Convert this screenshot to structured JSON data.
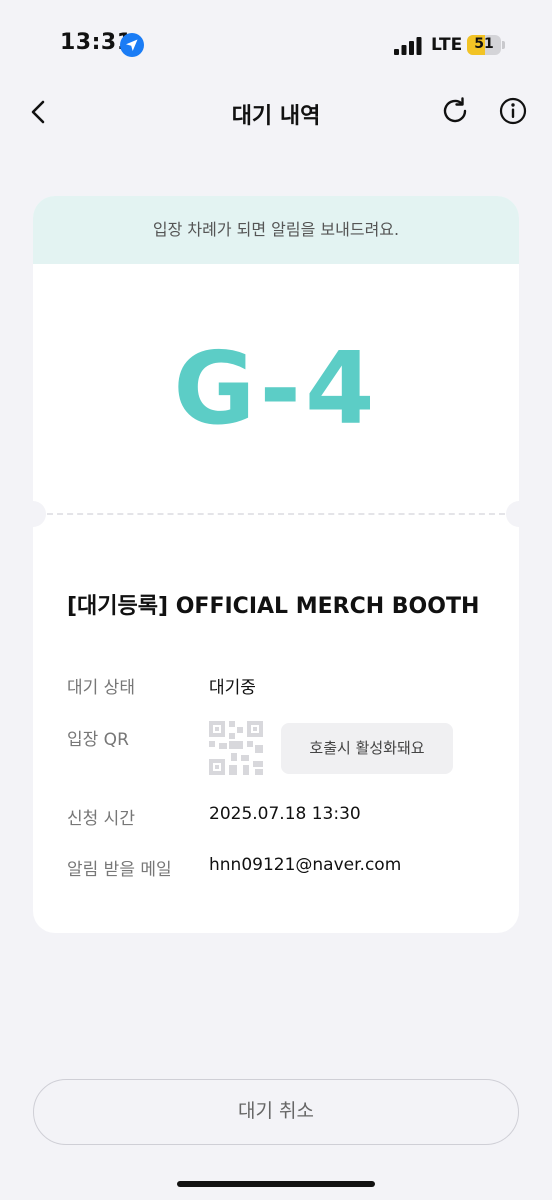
{
  "status_bar": {
    "time": "13:31",
    "network": "LTE",
    "battery_level": "51",
    "battery_color": "#f2c325"
  },
  "header": {
    "title": "대기 내역",
    "back_icon": "chevron-left-icon",
    "refresh_icon": "refresh-icon",
    "info_icon": "info-icon"
  },
  "ticket": {
    "banner": "입장 차례가 되면 알림을 보내드려요.",
    "number": "G-4",
    "number_color": "#5ccdc6",
    "event_title": "[대기등록] OFFICIAL MERCH BOOTH",
    "rows": [
      {
        "label": "대기 상태",
        "value": "대기중"
      },
      {
        "label": "입장 QR",
        "value": "호출시 활성화돼요"
      },
      {
        "label": "신청 시간",
        "value": "2025.07.18 13:30"
      },
      {
        "label": "알림 받을 메일",
        "value": "hnn09121@naver.com"
      }
    ]
  },
  "cancel_button": {
    "label": "대기 취소"
  }
}
